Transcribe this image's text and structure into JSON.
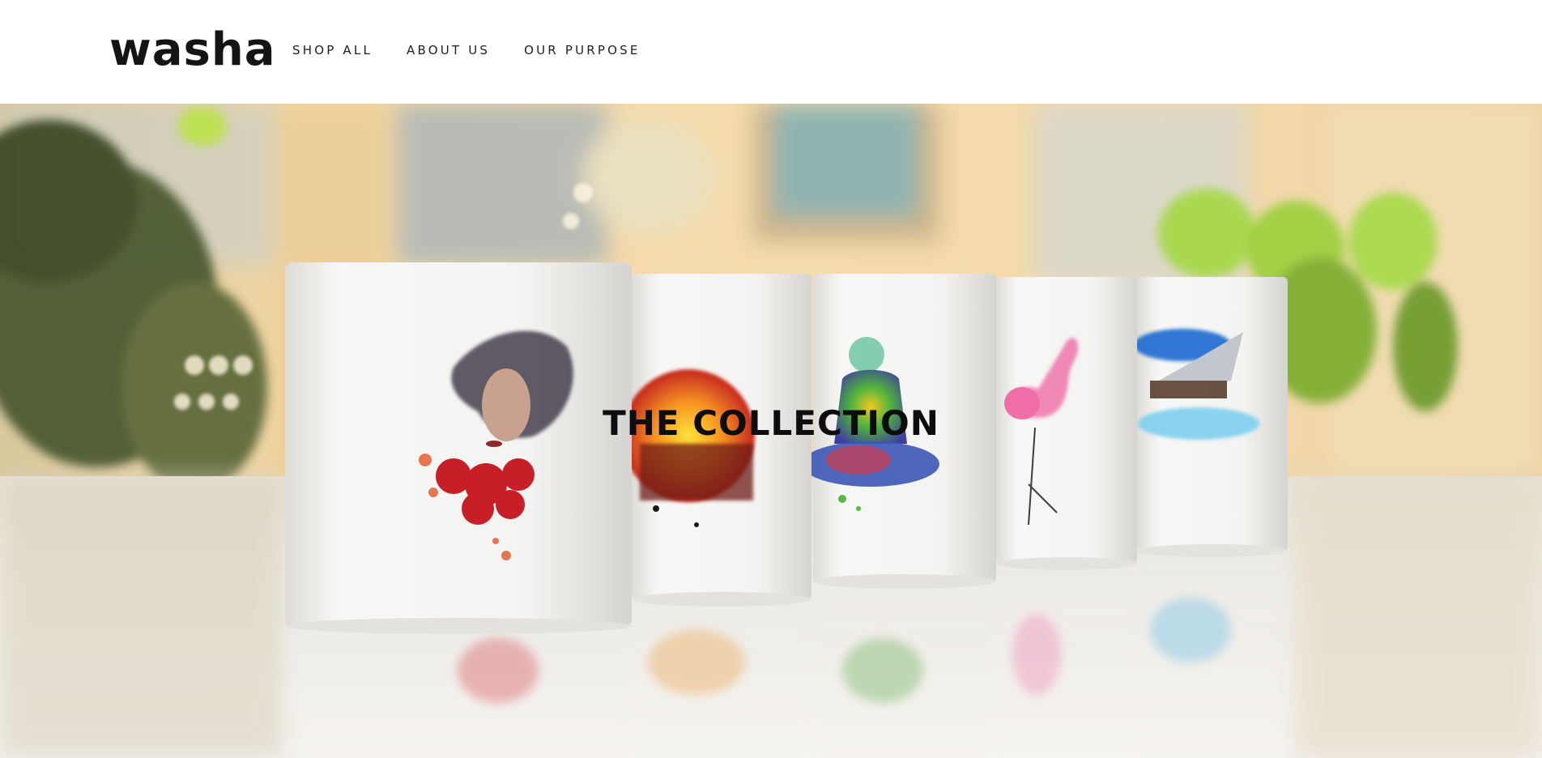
{
  "brand": {
    "logo_text": "washa"
  },
  "nav": {
    "items": [
      {
        "label": "SHOP ALL"
      },
      {
        "label": "ABOUT US"
      },
      {
        "label": "OUR PURPOSE"
      }
    ]
  },
  "hero": {
    "title": "THE COLLECTION",
    "image_subject": "five white mugs with watercolor prints on a reflective table"
  },
  "colors": {
    "text": "#141414",
    "header_bg": "#ffffff",
    "hero_warm_bg": "#efd8a8"
  }
}
